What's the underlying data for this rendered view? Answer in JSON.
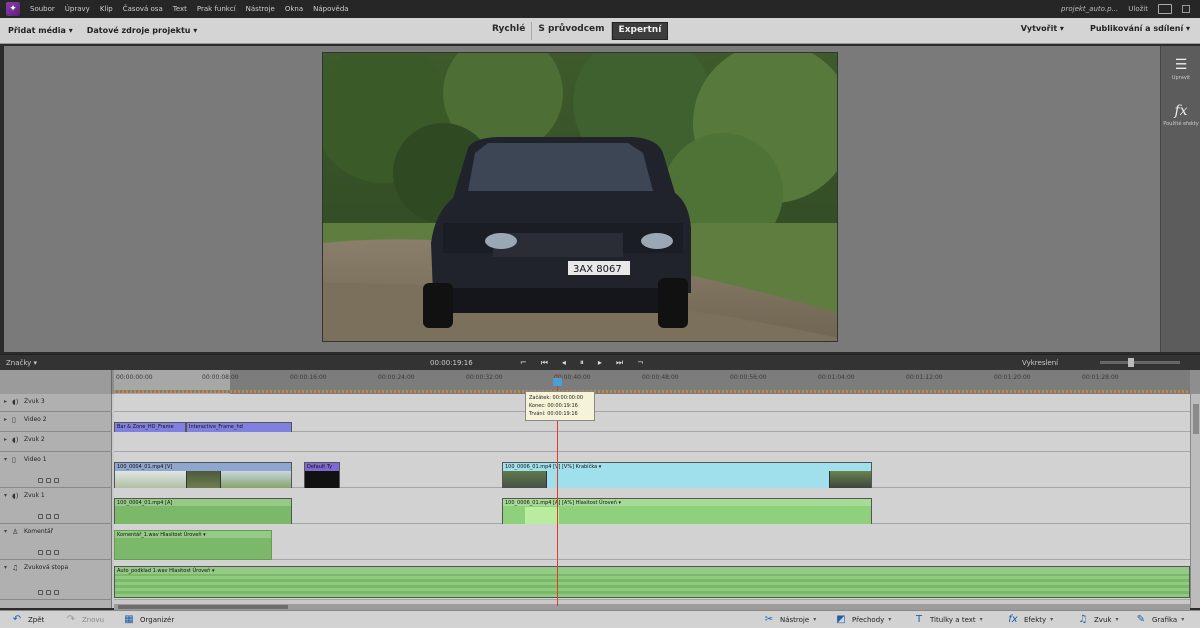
{
  "menubar": {
    "items": [
      "Soubor",
      "Úpravy",
      "Klip",
      "Časová osa",
      "Text",
      "Prak funkcí",
      "Nástroje",
      "Okna",
      "Nápověda"
    ],
    "project": "projekt_auto.p...",
    "undo": "Uložit"
  },
  "toolbar": {
    "add_media": "Přidat média",
    "project_assets": "Datové zdroje projektu",
    "modes": [
      "Rychlé",
      "S průvodcem",
      "Expertní"
    ],
    "active_mode": "Expertní",
    "create": "Vytvořit",
    "publish": "Publikování a sdílení"
  },
  "rightpanel": {
    "adjust_label": "Upravit",
    "fx_label": "Použité efekty"
  },
  "transport": {
    "markers": "Značky",
    "timecode": "00:00:19:16",
    "render": "Vykreslení"
  },
  "ruler": {
    "ticks": [
      "00:00:00:00",
      "00:00:08:00",
      "00:00:16:00",
      "00:00:24:00",
      "00:00:32:00",
      "00:00:40:00",
      "00:00:48:00",
      "00:00:56:00",
      "00:01:04:00",
      "00:01:12:00",
      "00:01:20:00",
      "00:01:28:00"
    ]
  },
  "tooltip": {
    "start": "Začátek: 00:00:00:00",
    "end": "Konec: 00:00:19:16",
    "duration": "Trvání: 00:00:19:16"
  },
  "tracks": {
    "zvuk3": "Zvuk 3",
    "video2": "Video 2",
    "zvuk2": "Zvuk 2",
    "video1": "Video 1",
    "zvuk1": "Zvuk 1",
    "komentar": "Komentář",
    "hudba": "Zvuková stopa"
  },
  "clips": {
    "v2a": "Bar & Zone_HD_Frame",
    "v2b": "Interactive_Frame_hd",
    "v1a": "100_0004_01.mp4 [V] ",
    "v1b": "Default Ty",
    "v1c": "100_0006_01.mp4 [V]  [V%]  Krabička ▾",
    "a1a": "100_0004_01.mp4 [A] ",
    "a1c": "100_0006_01.mp4 [A]  [A%]  Hlasitost Úroveň ▾",
    "kom": "Komentář_1.wav  Hlasitost Úroveň ▾",
    "hud": "Auto_podklad 1.wav  Hlasitost Úroveň ▾"
  },
  "bottombar": {
    "undo": "Zpět",
    "redo": "Znovu",
    "organizer": "Organizér",
    "tools": "Nástroje",
    "transitions": "Přechody",
    "titles": "Titulky a text",
    "effects": "Efekty",
    "audio": "Zvuk",
    "graphics": "Grafika"
  }
}
